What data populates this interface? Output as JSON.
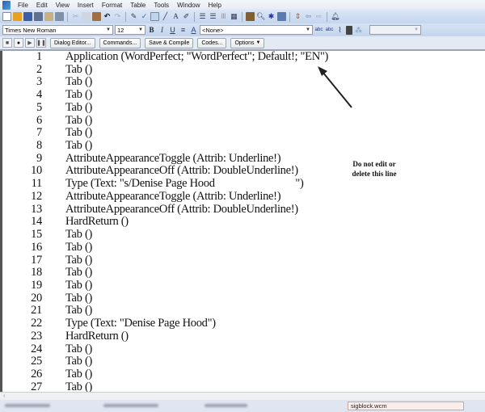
{
  "menu": [
    "File",
    "Edit",
    "View",
    "Insert",
    "Format",
    "Table",
    "Tools",
    "Window",
    "Help"
  ],
  "font": {
    "family": "Times New Roman",
    "size": "12",
    "style": "<None>"
  },
  "macro_toolbar": {
    "dialog_editor": "Dialog Editor...",
    "commands": "Commands...",
    "save_compile": "Save & Compile",
    "codes": "Codes...",
    "options": "Options"
  },
  "lines": [
    {
      "n": "1",
      "code": "Application (WordPerfect; \"WordPerfect\"; Default!; \"EN\")"
    },
    {
      "n": "2",
      "code": "Tab ()"
    },
    {
      "n": "3",
      "code": "Tab ()"
    },
    {
      "n": "4",
      "code": "Tab ()"
    },
    {
      "n": "5",
      "code": "Tab ()"
    },
    {
      "n": "6",
      "code": "Tab ()"
    },
    {
      "n": "7",
      "code": "Tab ()"
    },
    {
      "n": "8",
      "code": "Tab ()"
    },
    {
      "n": "9",
      "code": "AttributeAppearanceToggle (Attrib: Underline!)"
    },
    {
      "n": "10",
      "code": "AttributeAppearanceOff (Attrib: DoubleUnderline!)"
    },
    {
      "n": "11",
      "code": "Type (Text: \"s/Denise Page Hood                              \")"
    },
    {
      "n": "12",
      "code": "AttributeAppearanceToggle (Attrib: Underline!)"
    },
    {
      "n": "13",
      "code": "AttributeAppearanceOff (Attrib: DoubleUnderline!)"
    },
    {
      "n": "14",
      "code": "HardReturn ()"
    },
    {
      "n": "15",
      "code": "Tab ()"
    },
    {
      "n": "16",
      "code": "Tab ()"
    },
    {
      "n": "17",
      "code": "Tab ()"
    },
    {
      "n": "18",
      "code": "Tab ()"
    },
    {
      "n": "19",
      "code": "Tab ()"
    },
    {
      "n": "20",
      "code": "Tab ()"
    },
    {
      "n": "21",
      "code": "Tab ()"
    },
    {
      "n": "22",
      "code": "Type (Text: \"Denise Page Hood\")"
    },
    {
      "n": "23",
      "code": "HardReturn ()"
    },
    {
      "n": "24",
      "code": "Tab ()"
    },
    {
      "n": "25",
      "code": "Tab ()"
    },
    {
      "n": "26",
      "code": "Tab ()"
    },
    {
      "n": "27",
      "code": "Tab ()"
    }
  ],
  "annotation": {
    "line1": "Do not edit or",
    "line2": "delete this line"
  },
  "bottom": {
    "file_name": "sigblock.wcm"
  }
}
